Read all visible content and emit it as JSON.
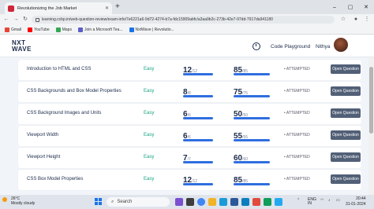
{
  "browser": {
    "tab_title": "Revolutionizing the Job Market",
    "url": "learning.ccbp.in/web-question-review/exam-info/7e6221a6-9d72-4274-b7a-fdc15909abfc/a3aa9b2c-273b-42e7-97dd-7917da941180",
    "bookmarks": [
      "Gmail",
      "YouTube",
      "Maps",
      "Join a Microsoft Tea...",
      "NxtWave | Revolutio..."
    ]
  },
  "header": {
    "logo_line1": "NXT",
    "logo_line2": "WAVE",
    "code_playground": "Code Playground",
    "user_name": "Nithya"
  },
  "questions": [
    {
      "title": "Introduction to HTML and CSS",
      "difficulty": "Easy",
      "score": "12",
      "score_total": "/12",
      "percent": "85",
      "percent_total": "/85",
      "status": "ATTEMPTED",
      "button": "Open Question",
      "fill_a": 1.0,
      "fill_b": 1.0
    },
    {
      "title": "CSS Backgrounds and Box Model Properties",
      "difficulty": "Easy",
      "score": "8",
      "score_total": "/8",
      "percent": "75",
      "percent_total": "/75",
      "status": "ATTEMPTED",
      "button": "Open Question",
      "fill_a": 1.0,
      "fill_b": 1.0
    },
    {
      "title": "CSS Background Images and Units",
      "difficulty": "Easy",
      "score": "6",
      "score_total": "/6",
      "percent": "50",
      "percent_total": "/50",
      "status": "ATTEMPTED",
      "button": "Open Question",
      "fill_a": 1.0,
      "fill_b": 1.0
    },
    {
      "title": "Viewport Width",
      "difficulty": "Easy",
      "score": "6",
      "score_total": "/6",
      "percent": "55",
      "percent_total": "/55",
      "status": "ATTEMPTED",
      "button": "Open Question",
      "fill_a": 1.0,
      "fill_b": 1.0
    },
    {
      "title": "Viewport Height",
      "difficulty": "Easy",
      "score": "7",
      "score_total": "/7",
      "percent": "60",
      "percent_total": "/60",
      "status": "ATTEMPTED",
      "button": "Open Question",
      "fill_a": 1.0,
      "fill_b": 1.0
    },
    {
      "title": "CSS Box Model Properties",
      "difficulty": "Easy",
      "score": "12",
      "score_total": "/12",
      "percent": "85",
      "percent_total": "/85",
      "status": "ATTEMPTED",
      "button": "Open Question",
      "fill_a": 1.0,
      "fill_b": 1.0
    }
  ],
  "taskbar": {
    "temp": "26°C",
    "weather": "Mostly cloudy",
    "search": "Search",
    "lang1": "ENG",
    "lang2": "IN",
    "time": "20:44",
    "date": "31-01-2024"
  },
  "colors": {
    "accent": "#2f6fe0",
    "easy": "#14a37f",
    "button": "#526077",
    "navy": "#1b2a4a"
  }
}
